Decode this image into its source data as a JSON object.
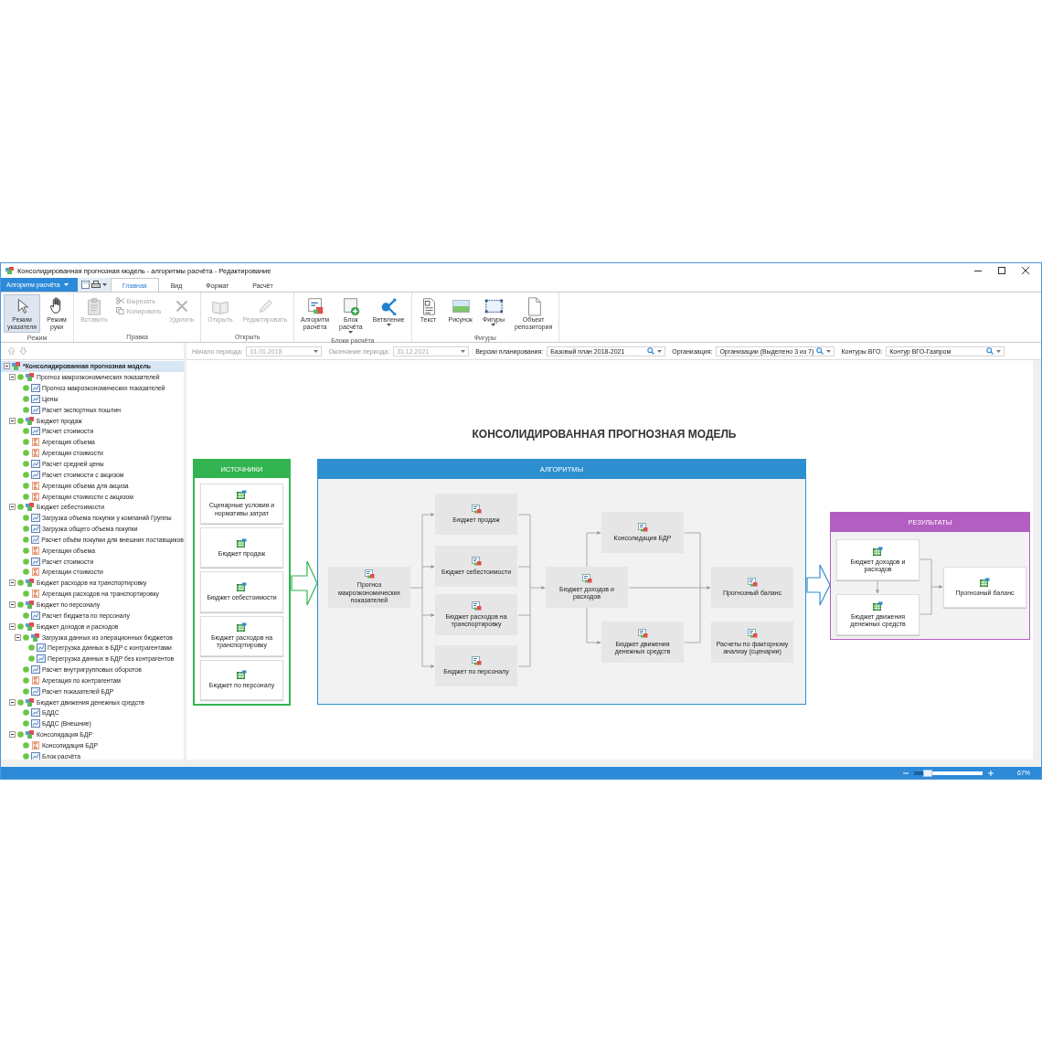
{
  "window": {
    "title": "Консолидированная прогнозная модель - алгоритмы расчёта - Редактирование"
  },
  "app_menu": {
    "label": "Алгоритм расчёта"
  },
  "tabs": [
    {
      "label": "Главная",
      "selected": true
    },
    {
      "label": "Вид",
      "selected": false
    },
    {
      "label": "Формат",
      "selected": false
    },
    {
      "label": "Расчёт",
      "selected": false
    }
  ],
  "ribbon": [
    {
      "label": "Режим",
      "buttons": [
        {
          "label": "Режим указателя",
          "kind": "large",
          "selected": true,
          "disabled": false
        },
        {
          "label": "Режим руки",
          "kind": "large",
          "selected": false,
          "disabled": false
        }
      ]
    },
    {
      "label": "Правка",
      "buttons": [
        {
          "label": "Вставить",
          "kind": "large",
          "selected": false,
          "disabled": true
        },
        {
          "label": "Вырезать",
          "kind": "small",
          "selected": false,
          "disabled": true
        },
        {
          "label": "Копировать",
          "kind": "small",
          "selected": false,
          "disabled": true
        },
        {
          "label": "Удалить",
          "kind": "large",
          "selected": false,
          "disabled": true
        }
      ]
    },
    {
      "label": "Открыть",
      "buttons": [
        {
          "label": "Открыть",
          "kind": "large",
          "selected": false,
          "disabled": true
        },
        {
          "label": "Редактировать",
          "kind": "large",
          "selected": false,
          "disabled": true
        }
      ]
    },
    {
      "label": "Блоки расчёта",
      "buttons": [
        {
          "label": "Алгоритм расчёта",
          "kind": "large",
          "selected": false,
          "disabled": false
        },
        {
          "label": "Блок расчёта",
          "kind": "large",
          "selected": false,
          "disabled": false,
          "dropdown": true
        },
        {
          "label": "Ветвление",
          "kind": "large",
          "selected": false,
          "disabled": false,
          "dropdown": true
        }
      ]
    },
    {
      "label": "Фигуры",
      "buttons": [
        {
          "label": "Текст",
          "kind": "large",
          "selected": false,
          "disabled": false
        },
        {
          "label": "Рисунок",
          "kind": "large",
          "selected": false,
          "disabled": false
        },
        {
          "label": "Фигуры",
          "kind": "large",
          "selected": false,
          "disabled": false,
          "dropdown": true
        },
        {
          "label": "Объект репозитория",
          "kind": "large",
          "selected": false,
          "disabled": false
        }
      ]
    }
  ],
  "filters": [
    {
      "label": "Начало периода:",
      "value": "01.01.2018",
      "kind": "date",
      "disabled": true
    },
    {
      "label": "Окончание периода:",
      "value": "31.12.2021",
      "kind": "date",
      "disabled": true
    },
    {
      "label": "Версии планирования:",
      "value": "Базовый план 2018-2021",
      "kind": "lookup",
      "disabled": false
    },
    {
      "label": "Организация:",
      "value": "Организации (Выделено 3 из 7)",
      "kind": "lookup",
      "disabled": false
    },
    {
      "label": "Контуры ВГО:",
      "value": "Контур ВГО-Газпром",
      "kind": "lookup",
      "disabled": false
    }
  ],
  "tree": [
    {
      "label": "*Консолидированная прогнозная модель",
      "kind": "root",
      "selected": true,
      "expanded": true,
      "children": [
        {
          "label": "Прогноз макроэкономических показателей",
          "kind": "group",
          "selected": false,
          "expanded": true,
          "children": [
            {
              "label": "Прогноз макроэкономических показателей",
              "kind": "calc",
              "selected": false
            },
            {
              "label": "Цены",
              "kind": "calc",
              "selected": false
            },
            {
              "label": "Расчет экспортных пошлин",
              "kind": "calc",
              "selected": false
            }
          ]
        },
        {
          "label": "Бюджет продаж",
          "kind": "group",
          "selected": false,
          "expanded": true,
          "children": [
            {
              "label": "Расчет стоимости",
              "kind": "calc",
              "selected": false
            },
            {
              "label": "Агрегация объема",
              "kind": "sum",
              "selected": false
            },
            {
              "label": "Агрегации стоимости",
              "kind": "sum",
              "selected": false
            },
            {
              "label": "Расчет средней цены",
              "kind": "calc",
              "selected": false
            },
            {
              "label": "Расчет стоимости с акцизом",
              "kind": "calc",
              "selected": false
            },
            {
              "label": "Агрегация объема для акциза",
              "kind": "sum",
              "selected": false
            },
            {
              "label": "Агрегации стоимости с акцизом",
              "kind": "sum",
              "selected": false
            }
          ]
        },
        {
          "label": "Бюджет себестоимости",
          "kind": "group",
          "selected": false,
          "expanded": true,
          "children": [
            {
              "label": "Загрузка объема покупки у компаний Группы",
              "kind": "calc",
              "selected": false
            },
            {
              "label": "Загрузка общего объема покупки",
              "kind": "calc",
              "selected": false
            },
            {
              "label": "Расчет объём покупки для внешних поставщиков",
              "kind": "calc",
              "selected": false
            },
            {
              "label": "Агрегации объема",
              "kind": "sum",
              "selected": false
            },
            {
              "label": "Расчет стоимости",
              "kind": "calc",
              "selected": false
            },
            {
              "label": "Агрегации стоимости",
              "kind": "sum",
              "selected": false
            }
          ]
        },
        {
          "label": "Бюджет расходов на транспортировку",
          "kind": "group",
          "selected": false,
          "expanded": true,
          "children": [
            {
              "label": "Агрегация расходов на транспортировку",
              "kind": "sum",
              "selected": false
            }
          ]
        },
        {
          "label": "Бюджет по персоналу",
          "kind": "group",
          "selected": false,
          "expanded": true,
          "children": [
            {
              "label": "Расчет бюджета по персоналу",
              "kind": "calc",
              "selected": false
            }
          ]
        },
        {
          "label": "Бюджет доходов и расходов",
          "kind": "group",
          "selected": false,
          "expanded": true,
          "children": [
            {
              "label": "Загрузка данных из операционных бюджетов",
              "kind": "group",
              "selected": false,
              "expanded": true,
              "children": [
                {
                  "label": "Перегрузка данных в БДР с контрагентами",
                  "kind": "calc",
                  "selected": false
                },
                {
                  "label": "Перегрузка данных в БДР без контрагентов",
                  "kind": "calc",
                  "selected": false
                }
              ]
            },
            {
              "label": "Расчет внутригрупповых оборотов",
              "kind": "calc",
              "selected": false
            },
            {
              "label": "Агрегация по контрагентам",
              "kind": "sum",
              "selected": false
            },
            {
              "label": "Расчет показателей БДР",
              "kind": "calc",
              "selected": false
            }
          ]
        },
        {
          "label": "Бюджет движения денежных средств",
          "kind": "group",
          "selected": false,
          "expanded": true,
          "children": [
            {
              "label": "БДДС",
              "kind": "calc",
              "selected": false
            },
            {
              "label": "БДДС (Внешние)",
              "kind": "calc",
              "selected": false
            }
          ]
        },
        {
          "label": "Консолидация БДР",
          "kind": "group",
          "selected": false,
          "expanded": true,
          "children": [
            {
              "label": "Консолидация БДР",
              "kind": "sum",
              "selected": false
            },
            {
              "label": "Блок расчёта",
              "kind": "calc",
              "selected": false
            }
          ]
        }
      ]
    }
  ],
  "diagram": {
    "title": "КОНСОЛИДИРОВАННАЯ ПРОГНОЗНАЯ МОДЕЛЬ",
    "sources": {
      "title": "ИСТОЧНИКИ",
      "items": [
        "Сценарные условия и нормативы затрат",
        "Бюджет продаж",
        "Бюджет себестоимости",
        "Бюджет расходов на транспортировку",
        "Бюджет по персоналу"
      ]
    },
    "algorithms": {
      "title": "АЛГОРИТМЫ",
      "nodes": [
        "Прогноз макроэкономических показателей",
        "Бюджет продаж",
        "Бюджет себестоимости",
        "Бюджет расходов на транспортировку",
        "Бюджет по персоналу",
        "Бюджет доходов и расходов",
        "Консолидация БДР",
        "Бюджет движения денежных средств",
        "Прогнозный баланс",
        "Расчеты по факторному анализу (сценарии)"
      ]
    },
    "results": {
      "title": "РЕЗУЛЬТАТЫ",
      "nodes": [
        "Бюджет доходов и расходов",
        "Бюджет движения денежных средств",
        "Прогнозный баланс"
      ]
    }
  },
  "status_bar": {
    "zoom": "67%",
    "level": 0.2
  }
}
